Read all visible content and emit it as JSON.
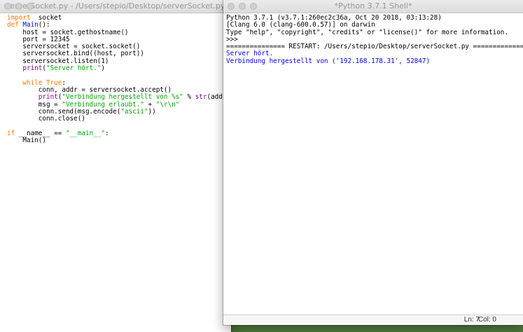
{
  "editor": {
    "title": "serverSocket.py - /Users/stepio/Desktop/serverSocket.py",
    "lines": [
      [
        [
          "kw",
          "import"
        ],
        [
          "",
          "  socket"
        ]
      ],
      [
        [
          "kw",
          "def"
        ],
        [
          "",
          ""
        ],
        [
          "fn",
          " Main"
        ],
        [
          "",
          "():"
        ]
      ],
      [
        [
          "",
          "    host = socket.gethostname()"
        ]
      ],
      [
        [
          "",
          "    port = 12345"
        ]
      ],
      [
        [
          "",
          "    serversocket = socket.socket()"
        ]
      ],
      [
        [
          "",
          "    serversocket.bind((host, port))"
        ]
      ],
      [
        [
          "",
          "    serversocket.listen(1)"
        ]
      ],
      [
        [
          "bi",
          "    print"
        ],
        [
          "",
          "("
        ],
        [
          "str",
          "\"Server hört.\""
        ],
        [
          "",
          ")"
        ]
      ],
      [
        [
          "",
          ""
        ]
      ],
      [
        [
          "kw",
          "    while"
        ],
        [
          "",
          ""
        ],
        [
          "kw",
          " True"
        ],
        [
          "",
          ":"
        ]
      ],
      [
        [
          "",
          "        conn, addr = serversocket.accept()"
        ]
      ],
      [
        [
          "bi",
          "        print"
        ],
        [
          "",
          "("
        ],
        [
          "str",
          "\"Verbindung hergestellt von %s\""
        ],
        [
          "",
          " % "
        ],
        [
          "bi",
          "str"
        ],
        [
          "",
          "(addr))"
        ]
      ],
      [
        [
          "",
          "        msg = "
        ],
        [
          "str",
          "\"Verbindung erlaubt.\""
        ],
        [
          "",
          " + "
        ],
        [
          "str",
          "\"\\r\\n\""
        ]
      ],
      [
        [
          "",
          "        conn.send(msg.encode("
        ],
        [
          "str",
          "\"ascii\""
        ],
        [
          "",
          "))"
        ]
      ],
      [
        [
          "",
          "        conn.close()"
        ]
      ],
      [
        [
          "",
          ""
        ]
      ],
      [
        [
          "kw",
          "if"
        ],
        [
          "",
          "",
          " __name__ == "
        ],
        [
          "",
          ""
        ],
        [
          "str",
          "\"__main__\""
        ],
        [
          "",
          ":"
        ]
      ],
      [
        [
          "",
          "    Main()"
        ]
      ]
    ]
  },
  "shell": {
    "title": "*Python 3.7.1 Shell*",
    "lines": [
      [
        [
          "",
          "Python 3.7.1 (v3.7.1:260ec2c36a, Oct 20 2018, 03:13:28)"
        ]
      ],
      [
        [
          "",
          "[Clang 6.0 (clang-600.0.57)] on darwin"
        ]
      ],
      [
        [
          "",
          "Type \"help\", \"copyright\", \"credits\" or \"license()\" for more information."
        ]
      ],
      [
        [
          "",
          ">>> "
        ]
      ],
      [
        [
          "",
          "=============== RESTART: /Users/stepio/Desktop/serverSocket.py ==============="
        ]
      ],
      [
        [
          "out",
          "Server hört."
        ]
      ],
      [
        [
          "out",
          "Verbindung hergestellt von ('192.168.178.31', 52847)"
        ]
      ]
    ],
    "status": {
      "line": "Ln: 7",
      "col": "Col: 0"
    }
  }
}
